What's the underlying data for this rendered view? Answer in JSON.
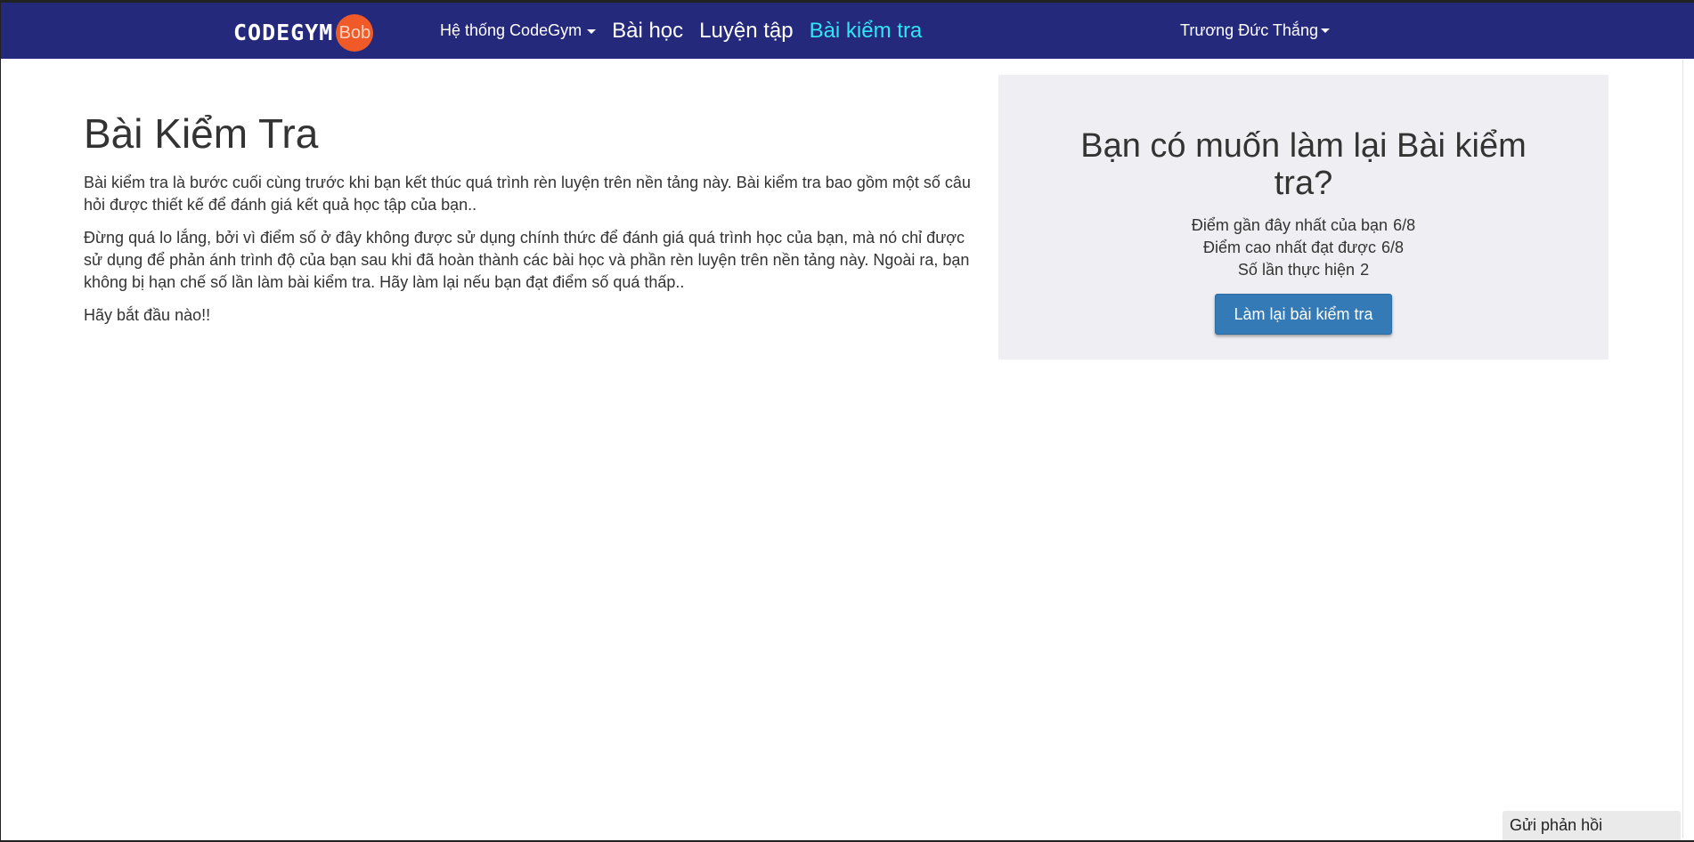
{
  "navbar": {
    "logo_text": "CODEGYM",
    "logo_badge": "Bob",
    "items": [
      {
        "label": "Hệ thống CodeGym"
      },
      {
        "label": "Bài học"
      },
      {
        "label": "Luyện tập"
      },
      {
        "label": "Bài kiểm tra"
      }
    ],
    "user_name": "Trương Đức Thắng",
    "colors": {
      "background": "#25297c",
      "active": "#30e6f5"
    }
  },
  "main": {
    "title": "Bài Kiểm Tra",
    "paragraphs": [
      "Bài kiểm tra là bước cuối cùng trước khi bạn kết thúc quá trình rèn luyện trên nền tảng này. Bài kiểm tra bao gồm một số câu hỏi được thiết kế để đánh giá kết quả học tập của bạn..",
      "Đừng quá lo lắng, bởi vì điểm số ở đây không được sử dụng chính thức để đánh giá quá trình học của bạn, mà nó chỉ được sử dụng để phản ánh trình độ của bạn sau khi đã hoàn thành các bài học và phần rèn luyện trên nền tảng này. Ngoài ra, bạn không bị hạn chế số lần làm bài kiểm tra. Hãy làm lại nếu bạn đạt điểm số quá thấp..",
      "Hãy bắt đầu nào!!"
    ]
  },
  "panel": {
    "title": "Bạn có muốn làm lại Bài kiểm tra?",
    "stats": [
      {
        "label": "Điểm gần đây nhất của bạn",
        "value": "6/8"
      },
      {
        "label": "Điểm cao nhất đạt được",
        "value": "6/8"
      },
      {
        "label": "Số lần thực hiện",
        "value": "2"
      }
    ],
    "button_label": "Làm lại bài kiểm tra",
    "button_color": "#337ab7"
  },
  "feedback": {
    "label": "Gửi phản hồi"
  }
}
